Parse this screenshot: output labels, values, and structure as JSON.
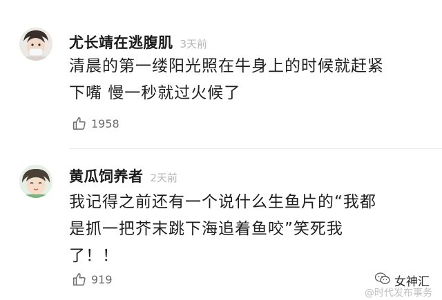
{
  "comments": [
    {
      "username": "尤长靖在逃腹肌",
      "time": "3天前",
      "lines": [
        "清晨的第一缕阳光照在牛身上的时候就赶紧",
        "下嘴 慢一秒就过火候了"
      ],
      "likes": "1958"
    },
    {
      "username": "黄瓜饲养者",
      "time": "2天前",
      "lines": [
        "我记得之前还有一个说什么生鱼片的“我都",
        "是抓一把芥末跳下海追着鱼咬”笑死我",
        "了！！"
      ],
      "likes": "919"
    }
  ],
  "watermark": {
    "logo_text": "女神汇",
    "handle": "@时代发布事务"
  },
  "icons": {
    "like": "thumbs-up-icon",
    "logo": "wechat-icon"
  },
  "colors": {
    "text": "#1e1e1e",
    "meta": "#b5b5b5",
    "like": "#6a6a6a"
  }
}
